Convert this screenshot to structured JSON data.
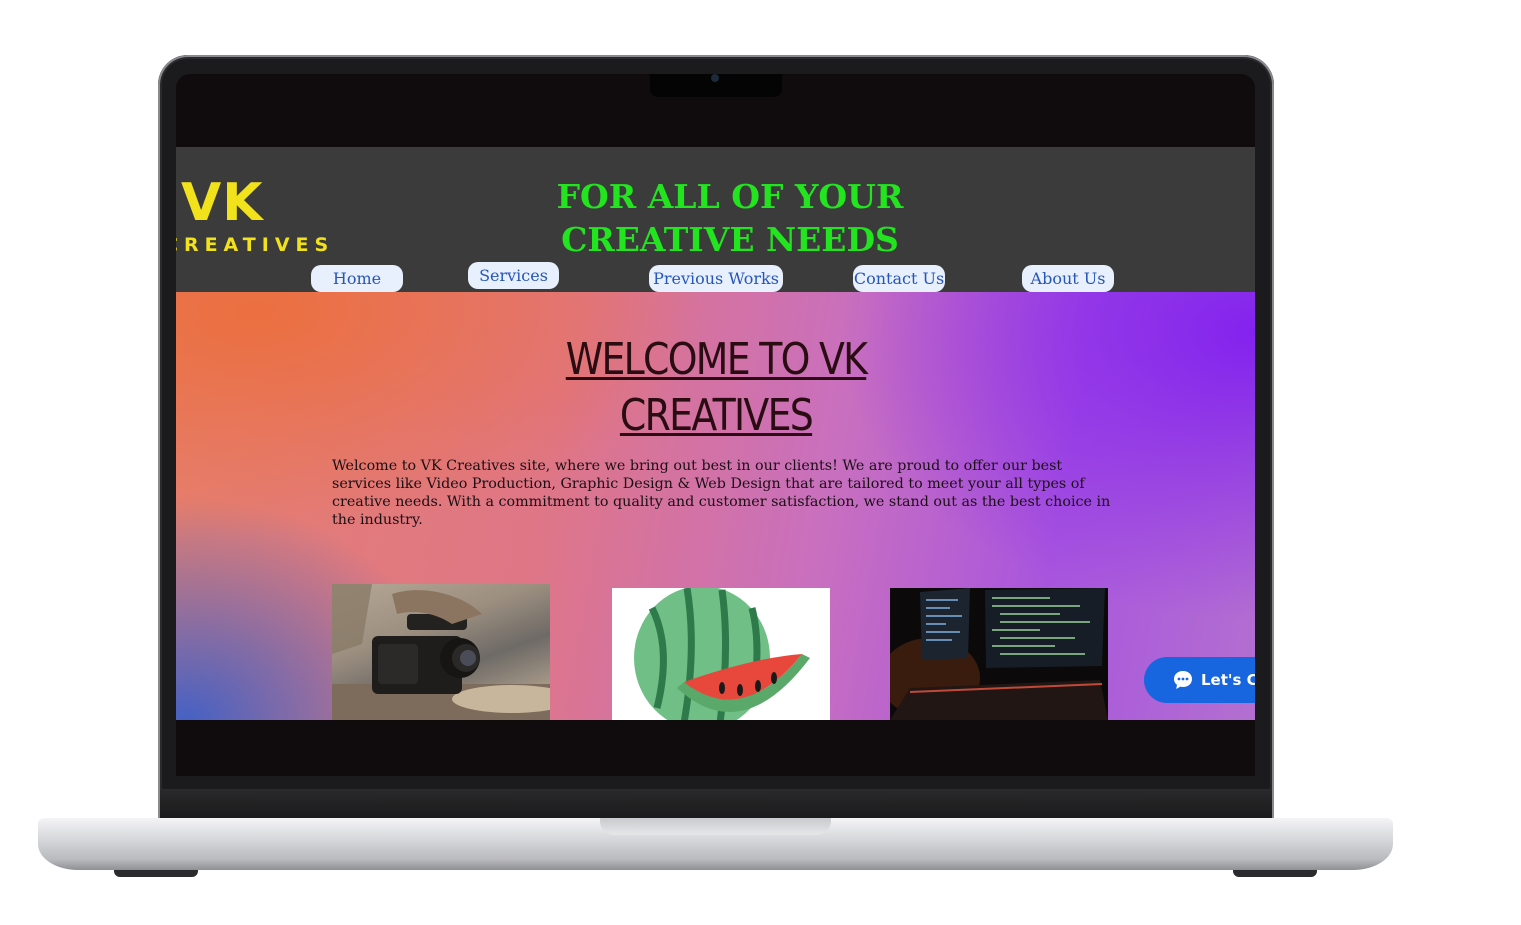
{
  "header": {
    "logo_main": "VK",
    "logo_sub": "CREATIVES",
    "tagline": "FOR ALL OF YOUR CREATIVE NEEDS"
  },
  "nav": {
    "items": [
      {
        "label": "Home"
      },
      {
        "label": "Services"
      },
      {
        "label": "Previous Works"
      },
      {
        "label": "Contact Us"
      },
      {
        "label": "About Us"
      }
    ]
  },
  "hero": {
    "title": "WELCOME TO VK CREATIVES",
    "body": "Welcome to VK Creatives site, where we bring out best in our clients! We are proud to offer our best services like Video Production, Graphic Design & Web Design that are tailored to meet your all types of creative needs. With a commitment to quality and customer satisfaction, we stand out as the best choice in the industry."
  },
  "gallery": [
    {
      "name": "video-camera-image"
    },
    {
      "name": "watermelon-illustration-image"
    },
    {
      "name": "code-monitor-image"
    }
  ],
  "chat": {
    "label": "Let's Ch",
    "icon": "chat-bubble-icon"
  },
  "colors": {
    "logo": "#f2e21c",
    "tagline": "#22e51f",
    "nav_text": "#2656b8",
    "chat_button": "#1766e0"
  }
}
